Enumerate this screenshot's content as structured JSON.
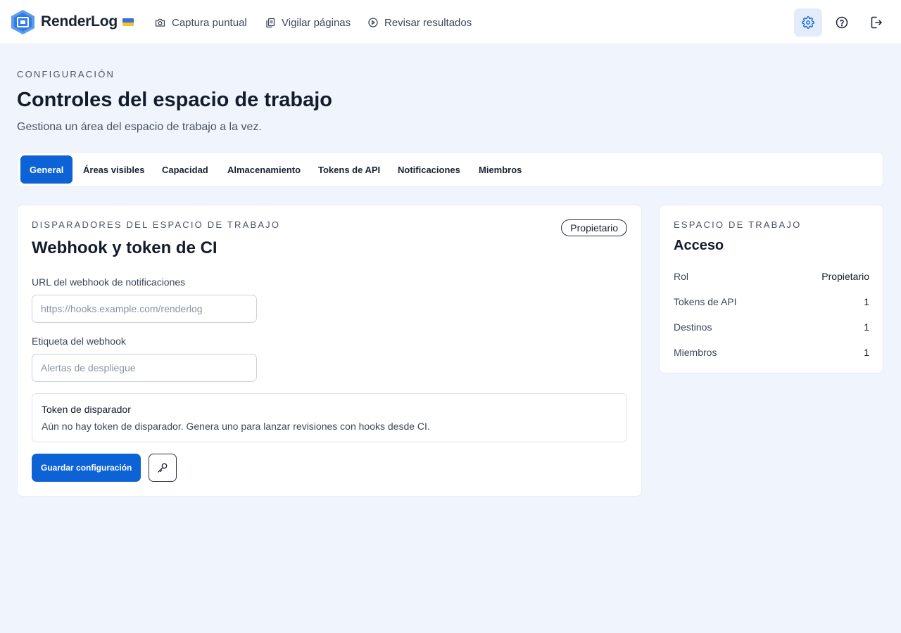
{
  "app": {
    "brand": "RenderLog",
    "accent_color": "#0d63d6",
    "flag_icon": "ukraine-flag-icon"
  },
  "nav": {
    "items": [
      {
        "label": "Captura puntual",
        "icon": "camera-icon"
      },
      {
        "label": "Vigilar páginas",
        "icon": "copy-pages-icon"
      },
      {
        "label": "Revisar resultados",
        "icon": "play-circle-icon"
      }
    ],
    "actions": [
      {
        "name": "settings",
        "icon": "gear-icon",
        "active": true
      },
      {
        "name": "help",
        "icon": "help-circle-icon",
        "active": false
      },
      {
        "name": "logout",
        "icon": "logout-icon",
        "active": false
      }
    ]
  },
  "page": {
    "eyebrow": "CONFIGURACIÓN",
    "title": "Controles del espacio de trabajo",
    "subtitle": "Gestiona un área del espacio de trabajo a la vez."
  },
  "tabs": [
    {
      "label": "General",
      "active": true
    },
    {
      "label": "Áreas visibles",
      "active": false
    },
    {
      "label": "Capacidad",
      "active": false
    },
    {
      "label": "Almacenamiento",
      "active": false
    },
    {
      "label": "Tokens de API",
      "active": false
    },
    {
      "label": "Notificaciones",
      "active": false
    },
    {
      "label": "Miembros",
      "active": false
    }
  ],
  "main_card": {
    "eyebrow": "DISPARADORES DEL ESPACIO DE TRABAJO",
    "title": "Webhook y token de CI",
    "badge": "Propietario",
    "webhook_url": {
      "label": "URL del webhook de notificaciones",
      "placeholder": "https://hooks.example.com/renderlog",
      "value": ""
    },
    "webhook_label": {
      "label": "Etiqueta del webhook",
      "placeholder": "Alertas de despliegue",
      "value": ""
    },
    "token": {
      "title": "Token de disparador",
      "text": "Aún no hay token de disparador. Genera uno para lanzar revisiones con hooks desde CI."
    },
    "save_label": "Guardar configuración",
    "key_button_icon": "key-icon"
  },
  "side_card": {
    "eyebrow": "ESPACIO DE TRABAJO",
    "title": "Acceso",
    "rows": [
      {
        "label": "Rol",
        "value": "Propietario"
      },
      {
        "label": "Tokens de API",
        "value": "1"
      },
      {
        "label": "Destinos",
        "value": "1"
      },
      {
        "label": "Miembros",
        "value": "1"
      }
    ]
  }
}
